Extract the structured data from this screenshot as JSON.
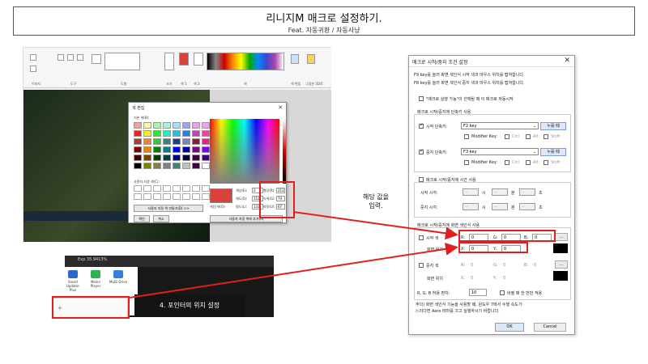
{
  "header": {
    "title": "리니지M 매크로 설정하기.",
    "subtitle": "Feat. 자동귀환 / 자동사냥"
  },
  "paint": {
    "ribbon_groups": [
      "이미지",
      "도구",
      "도형",
      "크기",
      "색 1",
      "색 2",
      "색",
      "색 편집",
      "그림판 3D로"
    ],
    "color_dialog": {
      "title": "색 편집",
      "basic_label": "기본 색(B):",
      "custom_label": "사용자 지정 색(C):",
      "define_button": "사용자 지정 색 만들기(D) >>",
      "ok": "확인",
      "cancel": "취소",
      "add_button": "사용자 지정 색에 추가(A)",
      "preview_label": "색|단색(O)",
      "hue_label": "색상(E):",
      "hue_value": "2",
      "sat_label": "채도(S):",
      "sat_value": "151",
      "lum_label": "명도(L):",
      "lum_value": "131",
      "red_label": "빨강(R):",
      "red_value": "212",
      "green_label": "녹색(G):",
      "green_value": "74",
      "blue_label": "파랑(U):",
      "blue_value": "67"
    }
  },
  "game2": {
    "status": "Exp 35.9413%",
    "desktop_icons": [
      "Smart Updater Plus",
      "Melon Player",
      "MuDi Drive"
    ],
    "tip": "4. 포인터의 위치 설정"
  },
  "annotation": {
    "line1": "해당 값을",
    "line2": "입력."
  },
  "macro": {
    "title": "매크로 시작/중지 조건 설정",
    "close": "✕",
    "info1": "F9 key를 눌러 화면 색인식 시작 색과 마우스 위치를 캡쳐합니다.",
    "info2": "F8 key를 눌러 화면 색인식 중지 색과 마우스 위치를 캡쳐합니다.",
    "auto_start_label": "\"매크로 실행 가능\"이 선택될 때 이 매크로 자동시작",
    "hotkey_section": "매크로 시작/중지에 단축키 사용",
    "start_hotkey_label": "시작 단축키:",
    "start_hotkey_value": "F2 key",
    "stop_hotkey_label": "중지 단축키:",
    "stop_hotkey_value": "F3 key",
    "capture_btn": "누를 때",
    "modifier_label": "Modifier Key:",
    "ctrl": "Ctrl",
    "alt": "Alt",
    "shift": "Shift",
    "time_section": "매크로 시작/중지에 시간 사용",
    "start_time_label": "시작 시각:",
    "stop_time_label": "중지 시각:",
    "time_placeholder": "--",
    "hour": "시",
    "minute": "분",
    "second": "초",
    "color_section": "매크로 시작/중지에 화면 색인식 사용",
    "start_color_label": "시작 색",
    "stop_color_label": "중지 색",
    "r_label": "R:",
    "g_label": "G:",
    "b_label": "B:",
    "zero": "0",
    "screen_pos_label": "화면 위치",
    "x_label": "X:",
    "y_label": "Y:",
    "tolerance_label": "R, G, B 허용 편차:",
    "tolerance_value": "10",
    "change_label": "바뀔 때 한 번만 적용",
    "note1": "주의) 화면 색인식 기능을 사용할 때, 윈도우 7에서 수행 속도가",
    "note2": "느리다면 Aero 테마를 끄고 실행하시기 바랍니다.",
    "ok": "OK",
    "cancel": "Cancel",
    "ellipsis": "..."
  },
  "colors": {
    "accent_red": "#e02020",
    "preview_red": "#d9413a"
  }
}
